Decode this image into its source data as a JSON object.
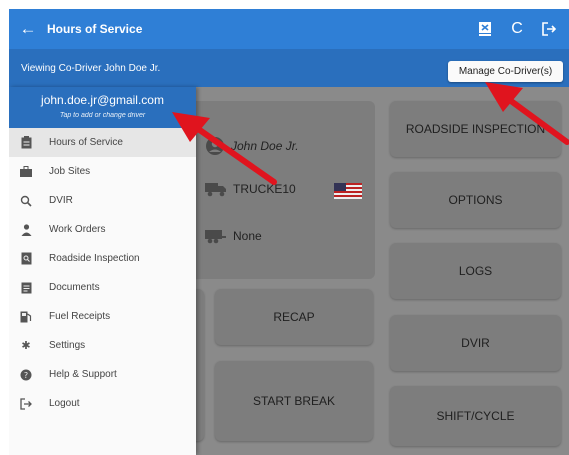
{
  "appbar": {
    "title": "Hours of Service",
    "icons": [
      "back-arrow-icon",
      "eld-icon",
      "refresh-icon",
      "logout-icon"
    ]
  },
  "subbar": {
    "viewing": "Viewing Co-Driver John Doe Jr.",
    "manage_label": "Manage Co-Driver(s)"
  },
  "drawer": {
    "email": "john.doe.jr@gmail.com",
    "hint": "Tap to add or change driver",
    "items": [
      {
        "label": "Hours of Service",
        "icon": "clipboard-icon"
      },
      {
        "label": "Job Sites",
        "icon": "briefcase-icon"
      },
      {
        "label": "DVIR",
        "icon": "search-icon"
      },
      {
        "label": "Work Orders",
        "icon": "person-icon"
      },
      {
        "label": "Roadside Inspection",
        "icon": "inspection-icon"
      },
      {
        "label": "Documents",
        "icon": "document-icon"
      },
      {
        "label": "Fuel Receipts",
        "icon": "fuel-icon"
      },
      {
        "label": "Settings",
        "icon": "gear-icon"
      },
      {
        "label": "Help & Support",
        "icon": "help-icon"
      },
      {
        "label": "Logout",
        "icon": "logout-icon"
      }
    ]
  },
  "main": {
    "driver_name": "John Doe Jr.",
    "truck": "TRUCKE10",
    "trailer": "None",
    "buttons": {
      "roadside": "ROADSIDE INSPECTION",
      "options": "OPTIONS",
      "logs": "LOGS",
      "dvir": "DVIR",
      "shift": "SHIFT/CYCLE",
      "recap": "RECAP",
      "start_break": "START BREAK"
    }
  },
  "colors": {
    "appbar": "#2f7fd6",
    "subbar": "#2a6fbd",
    "overlay": "#8a8a8a",
    "arrow": "#e0141e"
  }
}
